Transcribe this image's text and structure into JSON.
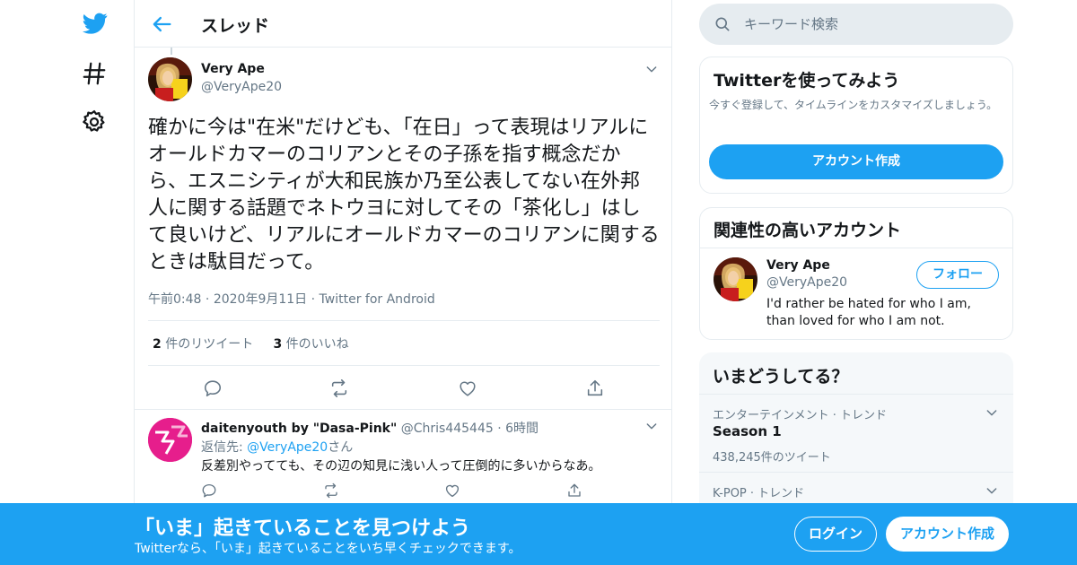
{
  "nav": {
    "logo_icon": "twitter-bird-icon",
    "items": [
      {
        "icon": "hashtag-icon"
      },
      {
        "icon": "gear-icon"
      }
    ]
  },
  "header": {
    "back_icon": "arrow-left-icon",
    "title": "スレッド"
  },
  "main_tweet": {
    "name": "Very Ape",
    "handle": "@VeryApe20",
    "text": "確かに今は\"在米\"だけども、「在日」って表現はリアルにオールドカマーのコリアンとその子孫を指す概念だから、エスニシティが大和民族か乃至公表してない在外邦人に関する話題でネトウヨに対してその「茶化し」はして良いけど、リアルにオールドカマーのコリアンに関するときは駄目だって。",
    "time": "午前0:48",
    "date": "2020年9月11日",
    "source": "Twitter for Android",
    "retweets": "2",
    "retweets_label": "件のリツイート",
    "likes": "3",
    "likes_label": "件のいいね"
  },
  "reply": {
    "name": "daitenyouth by \"Dasa-Pink\"",
    "handle": "@Chris445445",
    "time": "6時間",
    "reply_prefix": "返信先:",
    "reply_to": "@VeryApe20",
    "reply_suffix": "さん",
    "text": "反差別やってても、その辺の知見に浅い人って圧倒的に多いからなあ。"
  },
  "search": {
    "placeholder": "キーワード検索"
  },
  "signup_panel": {
    "title": "Twitterを使ってみよう",
    "description": "今すぐ登録して、タイムラインをカスタマイズしましょう。",
    "button": "アカウント作成"
  },
  "related_panel": {
    "title": "関連性の高いアカウント",
    "name": "Very Ape",
    "handle": "@VeryApe20",
    "follow": "フォロー",
    "bio": "I'd rather be hated for who I am, than loved for who I am not."
  },
  "trends_panel": {
    "title": "いまどうしてる？",
    "items": [
      {
        "category": "エンターテインメント · トレンド",
        "name": "Season 1",
        "count": "438,245件のツイート"
      },
      {
        "category": "K-POP · トレンド",
        "name": "",
        "count": ""
      }
    ]
  },
  "bottom_bar": {
    "title": "「いま」起きていることを見つけよう",
    "subtitle": "Twitterなら、「いま」起きていることをいち早くチェックできます。",
    "login": "ログイン",
    "signup": "アカウント作成"
  },
  "colors": {
    "accent": "#1da1f2",
    "text": "#14171a",
    "muted": "#657786",
    "border": "#e6ecf0"
  }
}
